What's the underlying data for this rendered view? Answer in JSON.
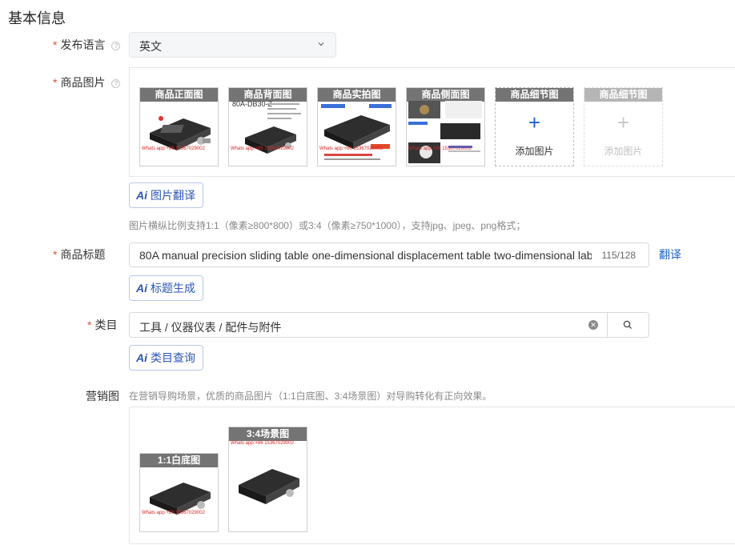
{
  "section_title": "基本信息",
  "language": {
    "label": "发布语言",
    "required_mark": "*",
    "value": "英文",
    "help_icon": "question-circle-icon"
  },
  "images": {
    "label": "商品图片",
    "required_mark": "*",
    "help_icon": "question-circle-icon",
    "thumbs": [
      {
        "caption": "商品正面图",
        "watermark": "Whats app:+86 15367029002"
      },
      {
        "caption": "商品背面图",
        "model_text": "80A-DB30-Z",
        "watermark": "Whats app:+86 15367029002"
      },
      {
        "caption": "商品实拍图",
        "watermark": "Whats app:+86 15367029002"
      },
      {
        "caption": "商品侧面图",
        "watermark": "Whats app:+86 15367029002"
      }
    ],
    "add_slots": [
      {
        "caption": "商品细节图",
        "add_text": "添加图片",
        "plus": "+",
        "state": "active"
      },
      {
        "caption": "商品细节图",
        "add_text": "添加图片",
        "plus": "+",
        "state": "disabled"
      }
    ],
    "translate_button": "图片翻译",
    "hint": "图片横纵比例支持1:1（像素≥800*800）或3:4（像素≥750*1000），支持jpg、jpeg、png格式；"
  },
  "title": {
    "label": "商品标题",
    "required_mark": "*",
    "value": "80A manual precision sliding table one-dimensional displacement table two-dimensional lab",
    "counter": "115/128",
    "translate_link": "翻译",
    "generate_button": "标题生成"
  },
  "category": {
    "label": "类目",
    "required_mark": "*",
    "value": "工具 / 仪器仪表 / 配件与附件",
    "query_button": "类目查询",
    "clear_icon": "clear-circle-icon",
    "search_icon": "search-icon"
  },
  "marketing": {
    "label": "营销图",
    "hint": "在营销导购场景，优质的商品图片（1:1白底图、3:4场景图）对导购转化有正向效果。",
    "thumbs": [
      {
        "caption": "1:1白底图",
        "watermark": "Whats app:+86 15367029002"
      },
      {
        "caption": "3:4场景图",
        "watermark": "Whats app:+86 15367029002"
      }
    ]
  },
  "ai_icon_text": "Ai",
  "colors": {
    "accent": "#1a63c9",
    "required": "#e34d3b",
    "ai_blue": "#2c57b8",
    "caption_bg": "#4a4a4a"
  }
}
